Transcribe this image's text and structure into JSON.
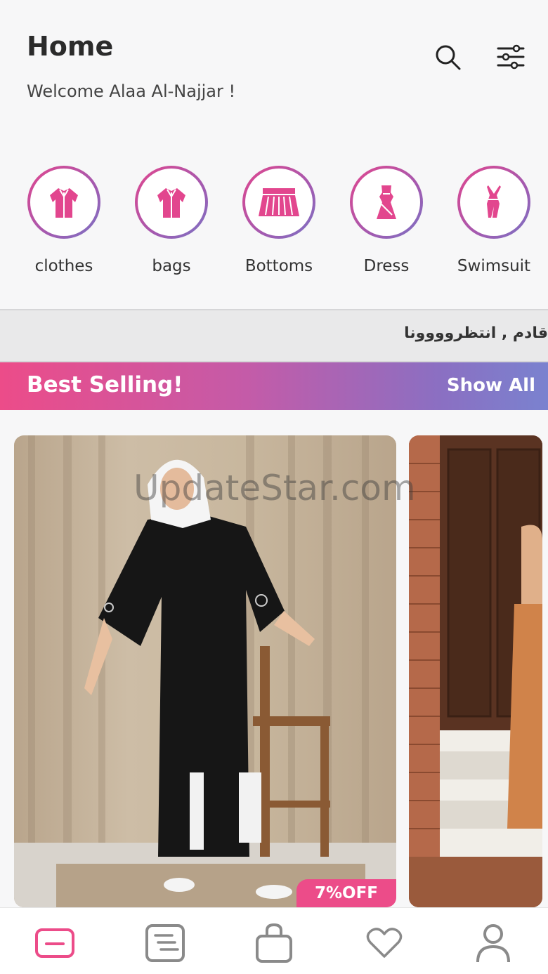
{
  "header": {
    "title": "Home",
    "welcome": "Welcome Alaa Al-Najjar !",
    "search_icon": "search-icon",
    "filter_icon": "sliders-icon"
  },
  "categories": [
    {
      "label": "clothes",
      "icon": "robe-icon"
    },
    {
      "label": "bags",
      "icon": "robe-icon"
    },
    {
      "label": "Bottoms",
      "icon": "skirt-icon"
    },
    {
      "label": "Dress",
      "icon": "dress-icon"
    },
    {
      "label": "Swimsuit",
      "icon": "swimsuit-icon"
    }
  ],
  "ticker": {
    "text": "قادم , انتظروووونا"
  },
  "best_selling": {
    "title": "Best Selling!",
    "show_all": "Show All"
  },
  "products": [
    {
      "discount": "7%OFF"
    },
    {
      "discount": ""
    }
  ],
  "watermark": "UpdateStar.com",
  "bottom_nav": [
    {
      "icon": "home-icon",
      "active": true
    },
    {
      "icon": "list-icon",
      "active": false
    },
    {
      "icon": "shopping-bag-icon",
      "active": false
    },
    {
      "icon": "heart-icon",
      "active": false
    },
    {
      "icon": "user-icon",
      "active": false
    }
  ],
  "colors": {
    "accent": "#ec4c89",
    "accent_secondary": "#7a82cf",
    "icon_inactive": "#8a8a8a"
  }
}
